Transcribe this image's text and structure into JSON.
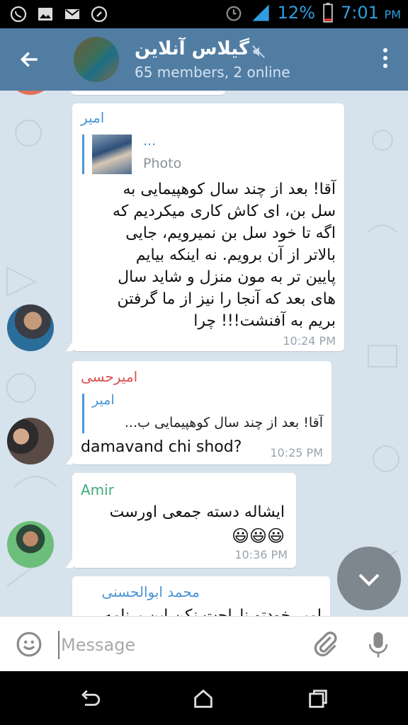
{
  "status_bar": {
    "battery": "12%",
    "time": "7:01",
    "ampm": "PM",
    "icons": [
      "whatsapp-icon",
      "gallery-icon",
      "gmail-icon",
      "phone-icon",
      "alarm-icon",
      "signal-icon",
      "battery-icon"
    ]
  },
  "header": {
    "title": "گیلاس آنلاین",
    "subtitle": "65 members, 2 online",
    "icons": [
      "back-arrow-icon",
      "muted-icon",
      "more-vert-icon"
    ]
  },
  "messages": [
    {
      "sender": "امیر",
      "sender_color": "#4a95d6",
      "reply_name": "...",
      "reply_text": "Photo",
      "lines": [
        "آقا! بعد از چند سال کوهپیمایی به",
        "سل بن، ای کاش کاری میکردیم که",
        "اگه تا خود سل بن نمیرویم، جایی",
        "بالاتر از آن برویم. نه اینکه بیایم",
        "پایین تر به مون منزل و شاید سال",
        "های بعد که آنجا را نیز از ما گرفتن",
        "بریم به آفنشت!!! چرا"
      ],
      "time": "10:24 PM"
    },
    {
      "sender": "امیرحسی",
      "sender_color": "#d9534f",
      "reply_name": "امیر",
      "reply_text": "آقا! بعد از چند سال کوهپیمایی ب...",
      "text": "damavand chi shod?",
      "time": "10:25 PM"
    },
    {
      "sender": "Amir",
      "sender_color": "#3fae7a",
      "text": "ایشاله دسته جمعی اورست",
      "emoji": "😃😃😃",
      "time": "10:36 PM"
    },
    {
      "sender": "محمد ابوالحسنی",
      "sender_color": "#4a95d6",
      "text": "امیر خودتو ناراحت نکن این برنامه"
    }
  ],
  "input": {
    "placeholder": "Message"
  },
  "colors": {
    "header_bg": "#527da3",
    "chat_bg": "#d6e2ec",
    "link": "#4a95d6"
  }
}
